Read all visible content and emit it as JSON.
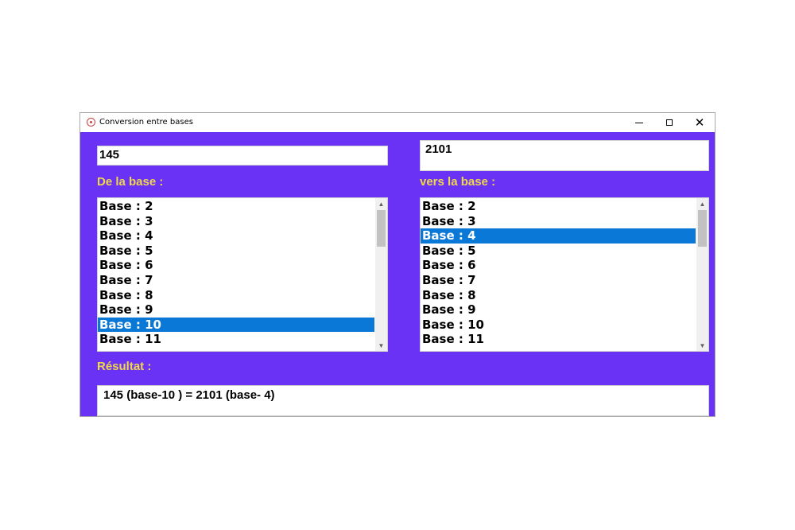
{
  "window": {
    "title": "Conversion entre bases",
    "icons": {
      "app": "app-icon",
      "minimize": "minimize-icon",
      "maximize": "maximize-icon",
      "close": "close-icon"
    },
    "close_glyph": "✕"
  },
  "colors": {
    "background": "#6a32f4",
    "label": "#f0d848",
    "selection": "#0a78d7"
  },
  "input_from": {
    "value": "145"
  },
  "input_to": {
    "value": "2101"
  },
  "labels": {
    "from": "De la base :",
    "to": "vers la base :",
    "result": "Résultat :"
  },
  "list_from": {
    "items": [
      "Base : 2",
      "Base : 3",
      "Base : 4",
      "Base : 5",
      "Base : 6",
      "Base : 7",
      "Base : 8",
      "Base : 9",
      "Base : 10",
      "Base : 11"
    ],
    "selected": "Base : 10"
  },
  "list_to": {
    "items": [
      "Base : 2",
      "Base : 3",
      "Base : 4",
      "Base : 5",
      "Base : 6",
      "Base : 7",
      "Base : 8",
      "Base : 9",
      "Base : 10",
      "Base : 11"
    ],
    "selected": "Base : 4"
  },
  "scrollbar": {
    "up_glyph": "▲",
    "down_glyph": "▼"
  },
  "result": {
    "text": "145 (base-10 ) = 2101 (base- 4)"
  }
}
